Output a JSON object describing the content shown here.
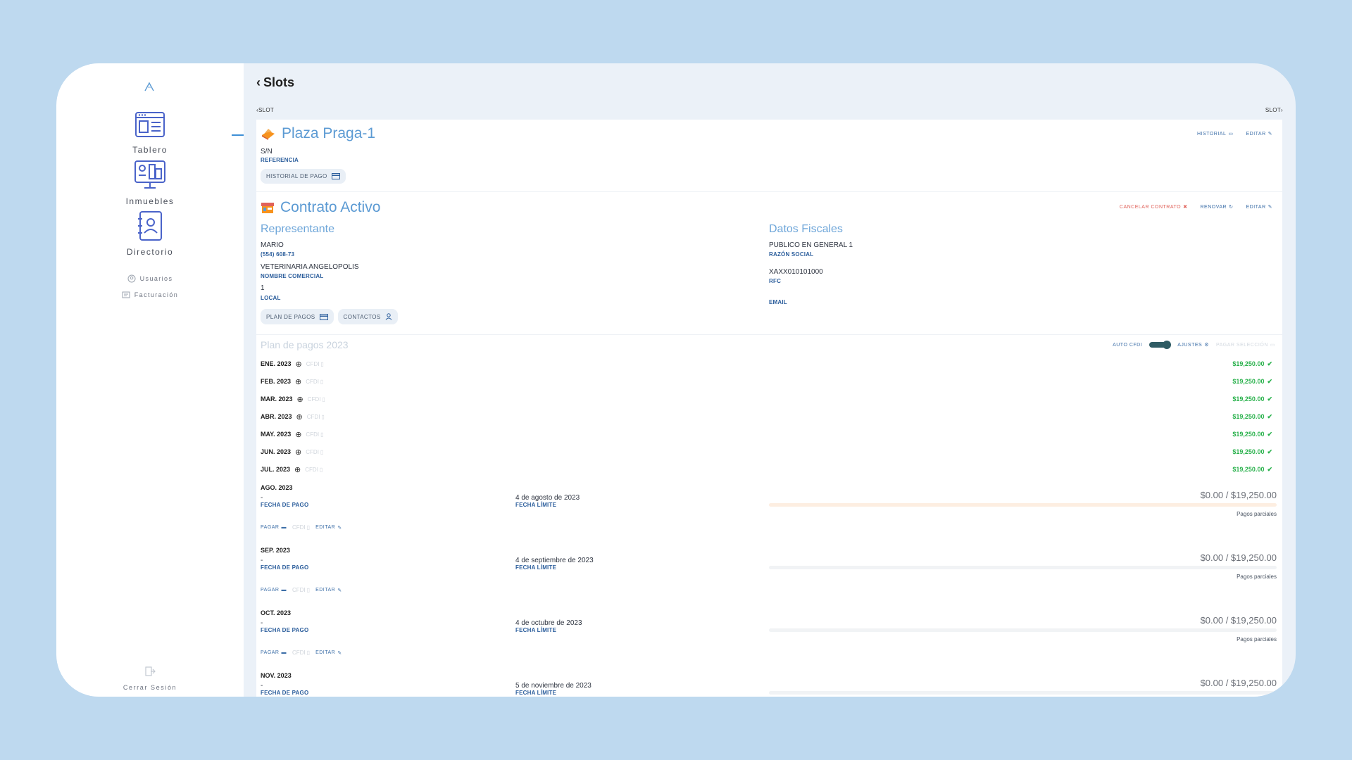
{
  "sidebar": {
    "nav": [
      {
        "label": "Tablero",
        "icon": "dashboard-icon"
      },
      {
        "label": "Inmuebles",
        "icon": "buildings-icon"
      },
      {
        "label": "Directorio",
        "icon": "contacts-book-icon"
      }
    ],
    "small_nav": [
      {
        "label": "Usuarios",
        "icon": "user-circle-icon"
      },
      {
        "label": "Facturación",
        "icon": "invoice-icon"
      }
    ],
    "logout": "Cerrar Sesión"
  },
  "header": {
    "title": "Slots",
    "prev_label": "SLOT",
    "next_label": "SLOT"
  },
  "property": {
    "name": "Plaza Praga-1",
    "reference_value": "S/N",
    "reference_label": "REFERENCIA",
    "history_button": "HISTORIAL DE PAGO",
    "actions": {
      "history": "HISTORIAL",
      "edit": "EDITAR"
    }
  },
  "contract": {
    "title": "Contrato Activo",
    "actions": {
      "cancel": "CANCELAR CONTRATO",
      "renew": "RENOVAR",
      "edit": "EDITAR"
    },
    "representative": {
      "title": "Representante",
      "name": "MARIO",
      "phone": "(554) 608-73",
      "commercial_name": "VETERINARIA ANGELOPOLIS",
      "commercial_name_label": "NOMBRE COMERCIAL",
      "local": "1",
      "local_label": "LOCAL"
    },
    "fiscal": {
      "title": "Datos Fiscales",
      "razon_social": "PUBLICO EN GENERAL 1",
      "razon_social_label": "RAZÓN SOCIAL",
      "rfc": "XAXX010101000",
      "rfc_label": "RFC",
      "email_label": "EMAIL"
    },
    "buttons": {
      "plan": "PLAN DE PAGOS",
      "contacts": "CONTACTOS"
    }
  },
  "plan": {
    "title": "Plan de pagos 2023",
    "auto_cfdi": "AUTO CFDI",
    "settings": "AJUSTES",
    "pay_selection": "PAGAR SELECCIÓN",
    "cfdi_label": "CFDI",
    "paid": [
      {
        "month": "ENE. 2023",
        "amount": "$19,250.00"
      },
      {
        "month": "FEB. 2023",
        "amount": "$19,250.00"
      },
      {
        "month": "MAR. 2023",
        "amount": "$19,250.00"
      },
      {
        "month": "ABR. 2023",
        "amount": "$19,250.00"
      },
      {
        "month": "MAY. 2023",
        "amount": "$19,250.00"
      },
      {
        "month": "JUN. 2023",
        "amount": "$19,250.00"
      },
      {
        "month": "JUL. 2023",
        "amount": "$19,250.00"
      }
    ],
    "pending": [
      {
        "month": "AGO. 2023",
        "fecha_pago": "-",
        "fecha_limite": "4 de agosto de 2023",
        "due": "$0.00 / $19,250.00",
        "progress": 0
      },
      {
        "month": "SEP. 2023",
        "fecha_pago": "-",
        "fecha_limite": "4 de septiembre de 2023",
        "due": "$0.00 / $19,250.00",
        "progress": 0
      },
      {
        "month": "OCT. 2023",
        "fecha_pago": "-",
        "fecha_limite": "4 de octubre de 2023",
        "due": "$0.00 / $19,250.00",
        "progress": 0
      },
      {
        "month": "NOV. 2023",
        "fecha_pago": "-",
        "fecha_limite": "5 de noviembre de 2023",
        "due": "$0.00 / $19,250.00",
        "progress": 0
      }
    ],
    "labels": {
      "fecha_pago": "FECHA DE PAGO",
      "fecha_limite": "FECHA LÍMITE",
      "parciales": "Pagos parciales",
      "pay": "PAGAR",
      "edit": "EDITAR"
    }
  },
  "colors": {
    "accent": "#5b9ad3",
    "paid": "#28b14b",
    "danger": "#e0625a",
    "background": "#bed9ef"
  }
}
